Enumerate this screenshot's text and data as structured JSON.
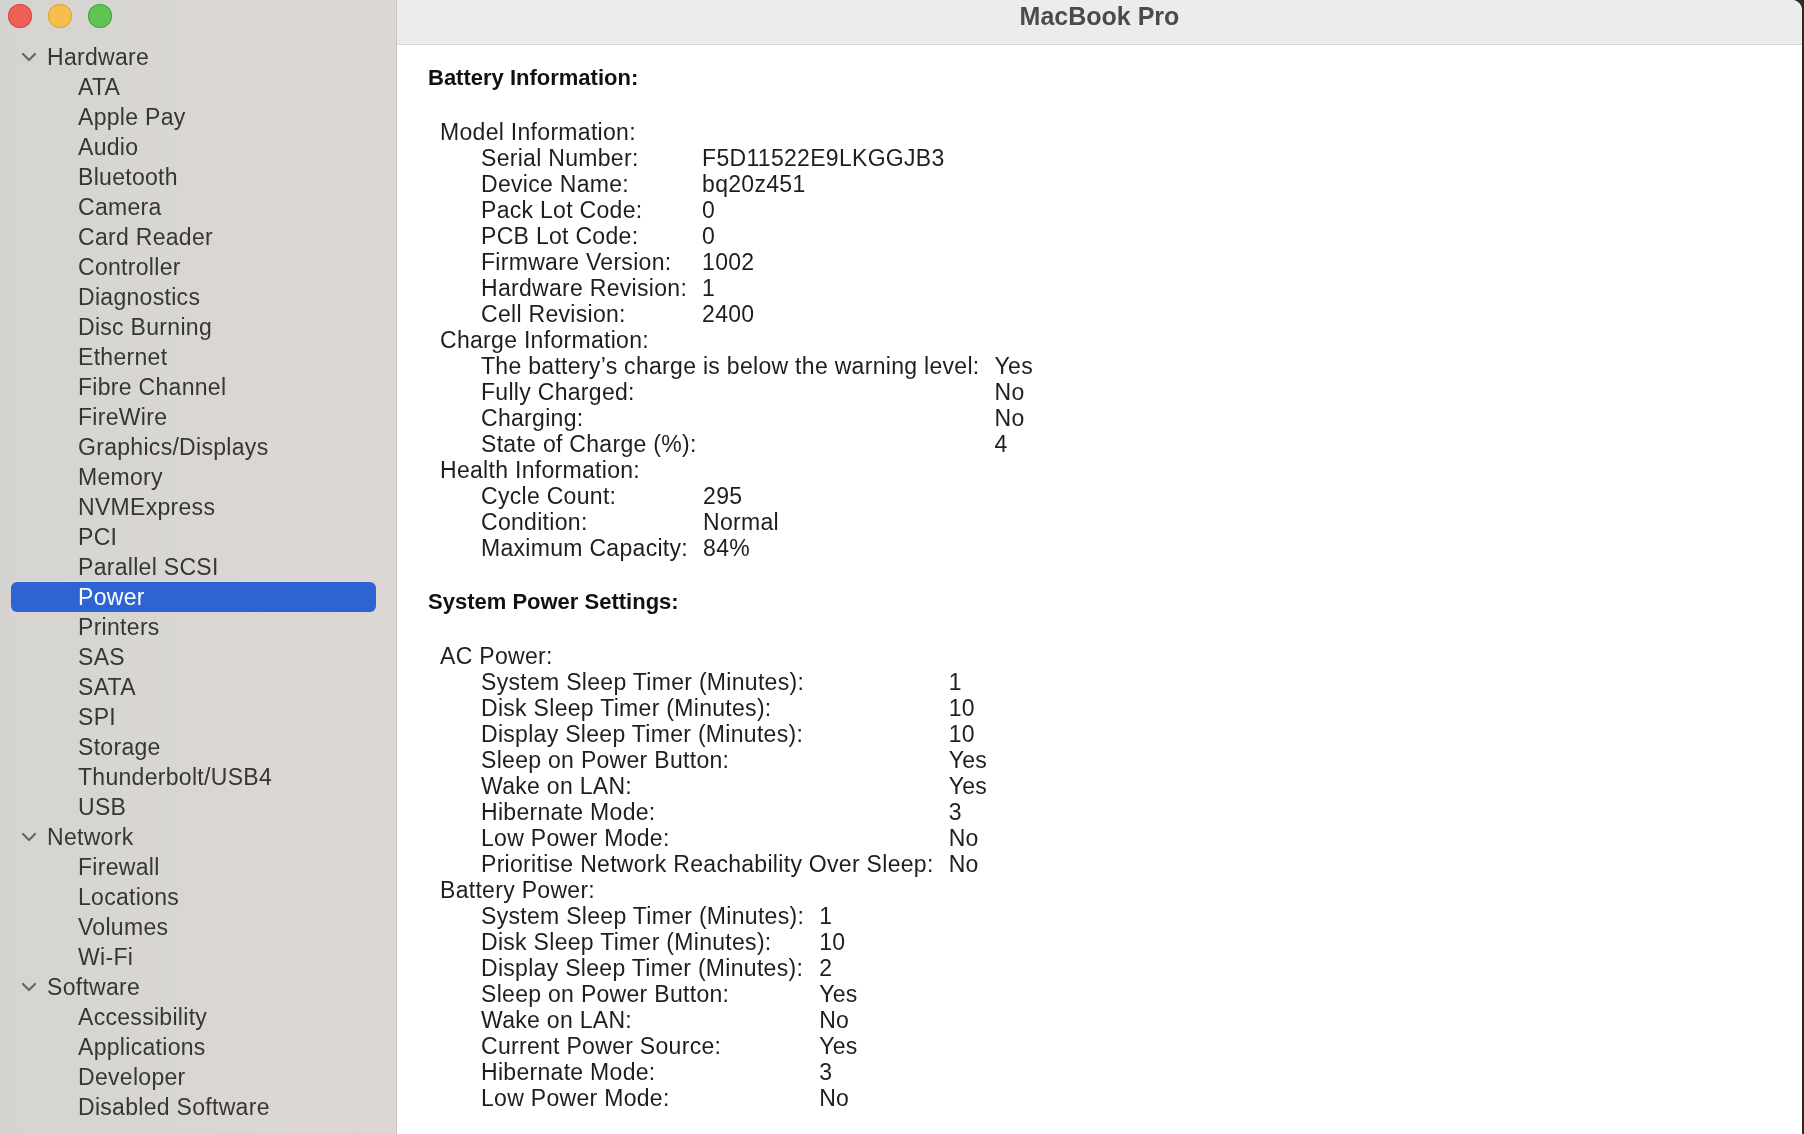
{
  "window": {
    "title": "MacBook Pro"
  },
  "sidebar": {
    "groups": [
      {
        "label": "Hardware",
        "expanded": true,
        "selected": false,
        "children": [
          {
            "label": "ATA",
            "selected": false
          },
          {
            "label": "Apple Pay",
            "selected": false
          },
          {
            "label": "Audio",
            "selected": false
          },
          {
            "label": "Bluetooth",
            "selected": false
          },
          {
            "label": "Camera",
            "selected": false
          },
          {
            "label": "Card Reader",
            "selected": false
          },
          {
            "label": "Controller",
            "selected": false
          },
          {
            "label": "Diagnostics",
            "selected": false
          },
          {
            "label": "Disc Burning",
            "selected": false
          },
          {
            "label": "Ethernet",
            "selected": false
          },
          {
            "label": "Fibre Channel",
            "selected": false
          },
          {
            "label": "FireWire",
            "selected": false
          },
          {
            "label": "Graphics/Displays",
            "selected": false
          },
          {
            "label": "Memory",
            "selected": false
          },
          {
            "label": "NVMExpress",
            "selected": false
          },
          {
            "label": "PCI",
            "selected": false
          },
          {
            "label": "Parallel SCSI",
            "selected": false
          },
          {
            "label": "Power",
            "selected": true
          },
          {
            "label": "Printers",
            "selected": false
          },
          {
            "label": "SAS",
            "selected": false
          },
          {
            "label": "SATA",
            "selected": false
          },
          {
            "label": "SPI",
            "selected": false
          },
          {
            "label": "Storage",
            "selected": false
          },
          {
            "label": "Thunderbolt/USB4",
            "selected": false
          },
          {
            "label": "USB",
            "selected": false
          }
        ]
      },
      {
        "label": "Network",
        "expanded": true,
        "selected": false,
        "children": [
          {
            "label": "Firewall",
            "selected": false
          },
          {
            "label": "Locations",
            "selected": false
          },
          {
            "label": "Volumes",
            "selected": false
          },
          {
            "label": "Wi-Fi",
            "selected": false
          }
        ]
      },
      {
        "label": "Software",
        "expanded": true,
        "selected": false,
        "children": [
          {
            "label": "Accessibility",
            "selected": false
          },
          {
            "label": "Applications",
            "selected": false
          },
          {
            "label": "Developer",
            "selected": false
          },
          {
            "label": "Disabled Software",
            "selected": false
          }
        ]
      }
    ]
  },
  "content": {
    "sections": [
      {
        "heading": "Battery Information:",
        "groups": [
          {
            "label": "Model Information:",
            "rows": [
              {
                "label": "Serial Number:",
                "value": "F5D11522E9LKGGJB3"
              },
              {
                "label": "Device Name:",
                "value": "bq20z451"
              },
              {
                "label": "Pack Lot Code:",
                "value": "0"
              },
              {
                "label": "PCB Lot Code:",
                "value": "0"
              },
              {
                "label": "Firmware Version:",
                "value": "1002"
              },
              {
                "label": "Hardware Revision:",
                "value": "1"
              },
              {
                "label": "Cell Revision:",
                "value": "2400"
              }
            ]
          },
          {
            "label": "Charge Information:",
            "rows": [
              {
                "label": "The battery’s charge is below the warning level:",
                "value": "Yes"
              },
              {
                "label": "Fully Charged:",
                "value": "No"
              },
              {
                "label": "Charging:",
                "value": "No"
              },
              {
                "label": "State of Charge (%):",
                "value": "4"
              }
            ]
          },
          {
            "label": "Health Information:",
            "rows": [
              {
                "label": "Cycle Count:",
                "value": "295"
              },
              {
                "label": "Condition:",
                "value": "Normal"
              },
              {
                "label": "Maximum Capacity:",
                "value": "84%"
              }
            ]
          }
        ]
      },
      {
        "heading": "System Power Settings:",
        "groups": [
          {
            "label": "AC Power:",
            "rows": [
              {
                "label": "System Sleep Timer (Minutes):",
                "value": "1"
              },
              {
                "label": "Disk Sleep Timer (Minutes):",
                "value": "10"
              },
              {
                "label": "Display Sleep Timer (Minutes):",
                "value": "10"
              },
              {
                "label": "Sleep on Power Button:",
                "value": "Yes"
              },
              {
                "label": "Wake on LAN:",
                "value": "Yes"
              },
              {
                "label": "Hibernate Mode:",
                "value": "3"
              },
              {
                "label": "Low Power Mode:",
                "value": "No"
              },
              {
                "label": "Prioritise Network Reachability Over Sleep:",
                "value": "No"
              }
            ]
          },
          {
            "label": "Battery Power:",
            "rows": [
              {
                "label": "System Sleep Timer (Minutes):",
                "value": "1"
              },
              {
                "label": "Disk Sleep Timer (Minutes):",
                "value": "10"
              },
              {
                "label": "Display Sleep Timer (Minutes):",
                "value": "2"
              },
              {
                "label": "Sleep on Power Button:",
                "value": "Yes"
              },
              {
                "label": "Wake on LAN:",
                "value": "No"
              },
              {
                "label": "Current Power Source:",
                "value": "Yes"
              },
              {
                "label": "Hibernate Mode:",
                "value": "3"
              },
              {
                "label": "Low Power Mode:",
                "value": "No"
              }
            ]
          }
        ]
      }
    ]
  }
}
